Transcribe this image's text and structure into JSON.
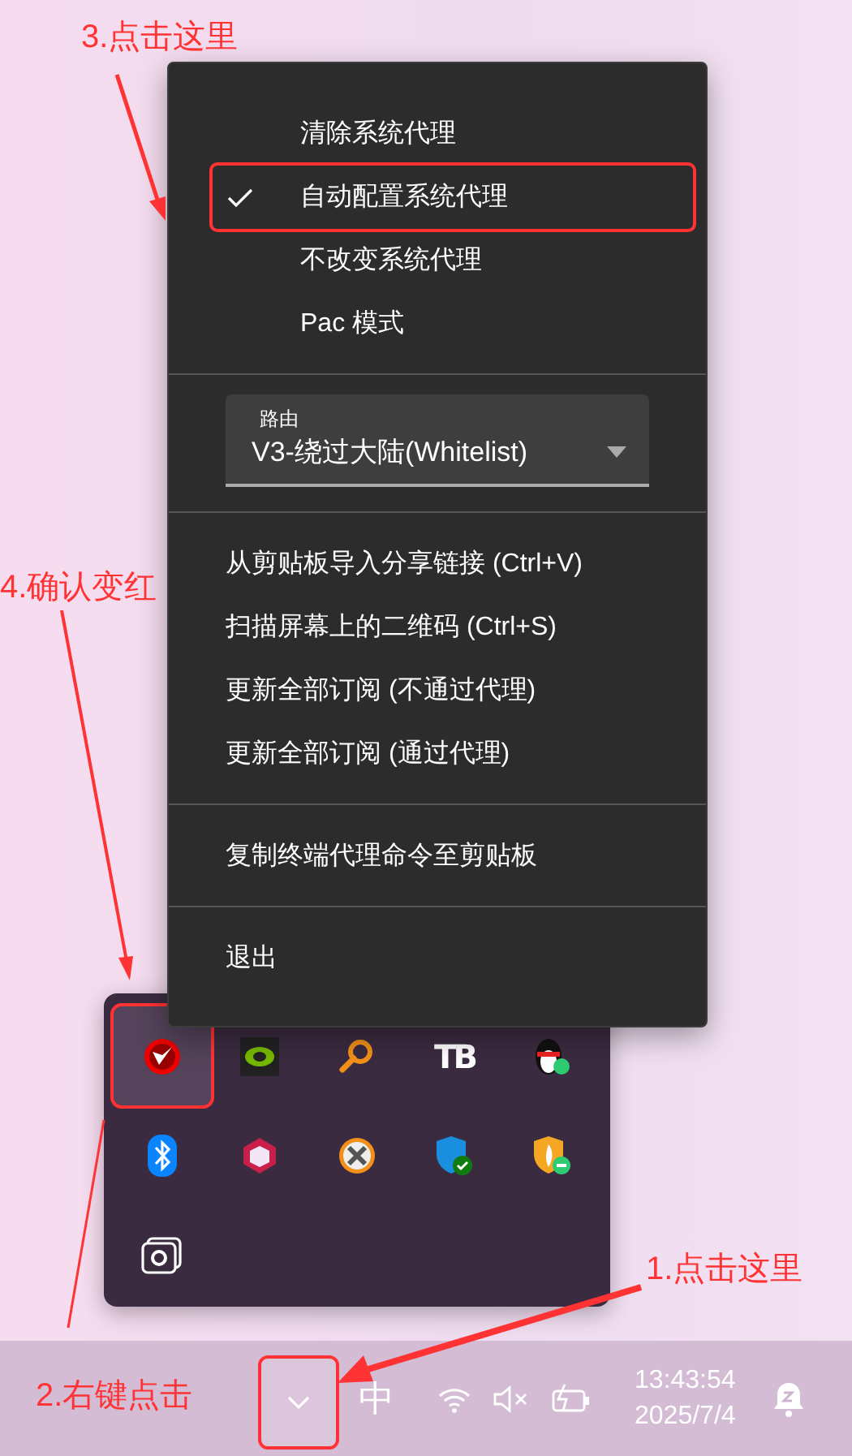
{
  "menu": {
    "sections": [
      {
        "kind": "checklist",
        "items": [
          {
            "label": "清除系统代理",
            "checked": false,
            "highlighted": false
          },
          {
            "label": "自动配置系统代理",
            "checked": true,
            "highlighted": true
          },
          {
            "label": "不改变系统代理",
            "checked": false,
            "highlighted": false
          },
          {
            "label": "Pac 模式",
            "checked": false,
            "highlighted": false
          }
        ]
      },
      {
        "kind": "select",
        "label": "路由",
        "value": "V3-绕过大陆(Whitelist)"
      },
      {
        "kind": "list",
        "items": [
          {
            "label": "从剪贴板导入分享链接 (Ctrl+V)"
          },
          {
            "label": "扫描屏幕上的二维码 (Ctrl+S)"
          },
          {
            "label": "更新全部订阅 (不通过代理)"
          },
          {
            "label": "更新全部订阅 (通过代理)"
          }
        ]
      },
      {
        "kind": "list",
        "items": [
          {
            "label": "复制终端代理命令至剪贴板"
          }
        ]
      },
      {
        "kind": "list",
        "items": [
          {
            "label": "退出"
          }
        ]
      }
    ]
  },
  "tray": {
    "icons": [
      {
        "highlighted": true
      },
      {
        "highlighted": false
      },
      {
        "highlighted": false
      },
      {
        "highlighted": false,
        "text": "TB"
      },
      {
        "highlighted": false
      },
      {
        "highlighted": false
      },
      {
        "highlighted": false
      },
      {
        "highlighted": false
      },
      {
        "highlighted": false
      },
      {
        "highlighted": false
      },
      {
        "highlighted": false
      }
    ]
  },
  "taskbar": {
    "chevron_highlighted": true,
    "ime": "中",
    "time": "13:43:54",
    "date": "2025/7/4"
  },
  "annotations": [
    {
      "text": "3.点击这里"
    },
    {
      "text": "4.确认变红"
    },
    {
      "text": "1.点击这里"
    },
    {
      "text": "2.右键点击"
    }
  ]
}
